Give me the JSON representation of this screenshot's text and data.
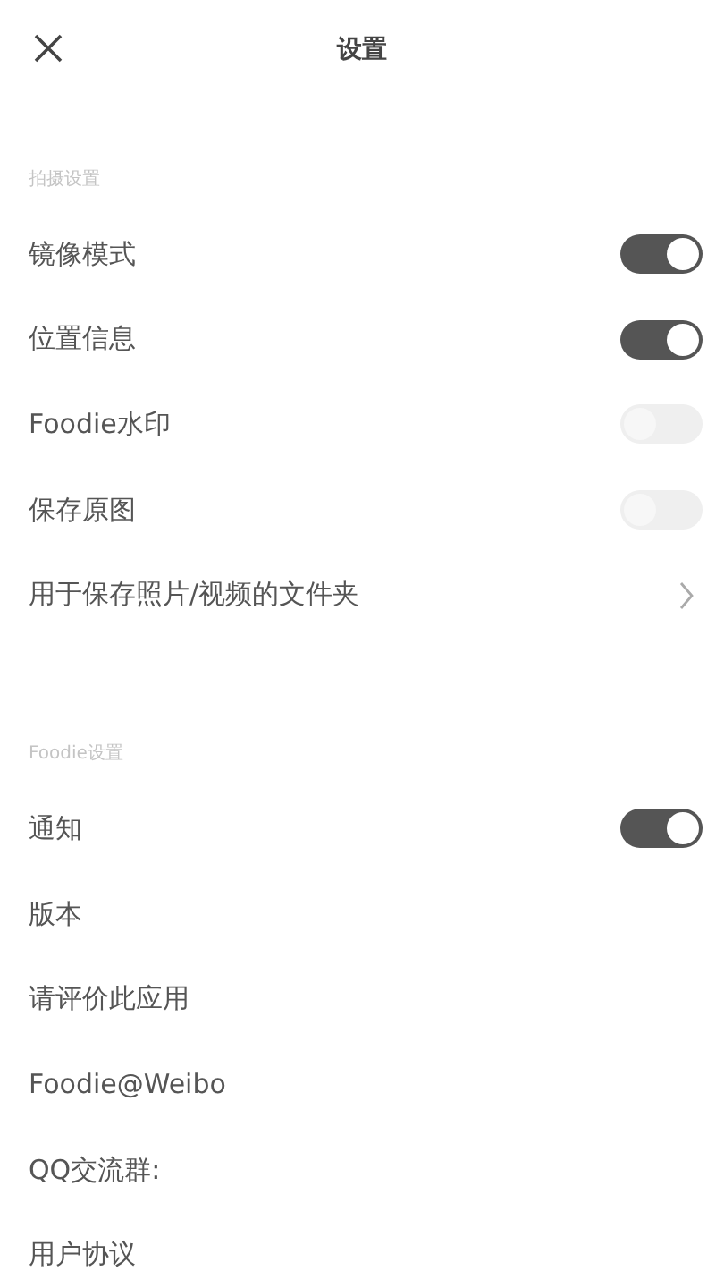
{
  "header": {
    "title": "设置"
  },
  "sections": [
    {
      "title": "拍摄设置",
      "items": [
        {
          "label": "镜像模式",
          "kind": "toggle",
          "on": true
        },
        {
          "label": "位置信息",
          "kind": "toggle",
          "on": true
        },
        {
          "label": "Foodie水印",
          "kind": "toggle",
          "on": false
        },
        {
          "label": "保存原图",
          "kind": "toggle",
          "on": false
        },
        {
          "label": "用于保存照片/视频的文件夹",
          "kind": "link"
        }
      ]
    },
    {
      "title": "Foodie设置",
      "items": [
        {
          "label": "通知",
          "kind": "toggle",
          "on": true
        },
        {
          "label": "版本",
          "kind": "plain"
        },
        {
          "label": "请评价此应用",
          "kind": "plain"
        },
        {
          "label": "Foodie@Weibo",
          "kind": "plain"
        },
        {
          "label": "QQ交流群:",
          "kind": "plain"
        },
        {
          "label": "用户协议",
          "kind": "plain"
        }
      ]
    }
  ]
}
